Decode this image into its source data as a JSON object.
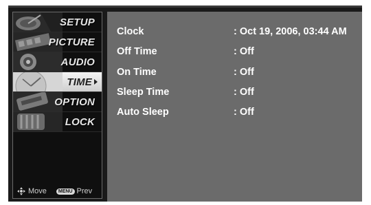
{
  "menu": {
    "items": [
      {
        "label": "SETUP",
        "icon": "satellite-dish-icon"
      },
      {
        "label": "PICTURE",
        "icon": "film-strip-icon"
      },
      {
        "label": "AUDIO",
        "icon": "speaker-icon"
      },
      {
        "label": "TIME",
        "icon": "clock-icon",
        "selected": true
      },
      {
        "label": "OPTION",
        "icon": "option-tag-icon"
      },
      {
        "label": "LOCK",
        "icon": "padlock-icon"
      }
    ]
  },
  "hint": {
    "move_label": "Move",
    "menu_key_label": "MENU",
    "prev_label": "Prev"
  },
  "settings": {
    "rows": [
      {
        "name": "Clock",
        "value": ": Oct 19, 2006, 03:44 AM"
      },
      {
        "name": "Off Time",
        "value": ": Off"
      },
      {
        "name": "On Time",
        "value": ": Off"
      },
      {
        "name": "Sleep Time",
        "value": ": Off"
      },
      {
        "name": "Auto Sleep",
        "value": ": Off"
      }
    ]
  },
  "colors": {
    "panel": "#6b6b6b",
    "sidebar": "#0f0f0f",
    "selected_item": "#e0e0e0",
    "text": "#ffffff"
  }
}
